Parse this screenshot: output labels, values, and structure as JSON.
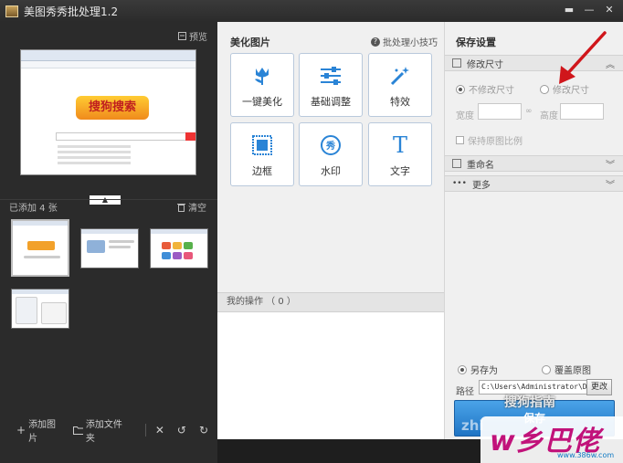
{
  "window": {
    "title": "美图秀秀批处理1.2",
    "controls": [
      "▬",
      "—",
      "✕"
    ]
  },
  "left_panel": {
    "preview_label": "预览",
    "added_count_label": "已添加 4 张",
    "clear_label": "清空",
    "collapse_glyph": "▲",
    "toolbar": {
      "add_image": "添加图片",
      "add_folder": "添加文件夹"
    }
  },
  "middle_panel": {
    "title": "美化图片",
    "tips_label": "批处理小技巧",
    "tools": [
      {
        "label": "一键美化",
        "icon": "tulip-icon"
      },
      {
        "label": "基础调整",
        "icon": "sliders-icon"
      },
      {
        "label": "特效",
        "icon": "magic-wand-icon"
      },
      {
        "label": "边框",
        "icon": "frame-icon"
      },
      {
        "label": "水印",
        "icon": "watermark-icon"
      },
      {
        "label": "文字",
        "icon": "text-icon"
      }
    ],
    "ops_label": "我的操作 （ 0 ）"
  },
  "right_panel": {
    "title": "保存设置",
    "resize_section": "修改尺寸",
    "no_resize": "不修改尺寸",
    "resize": "修改尺寸",
    "width_label": "宽度",
    "height_label": "高度",
    "keep_ratio": "保持原图比例",
    "rename_section": "重命名",
    "more_section": "更多",
    "save_as": "另存为",
    "overwrite": "覆盖原图",
    "path_label": "路径",
    "path_value": "C:\\Users\\Administrator\\De:",
    "change_button": "更改",
    "save_button": "保存"
  },
  "watermarks": {
    "sogou_guide": "搜狗指南",
    "site_logo": "w乡巴佬",
    "site_url": "www.386w.com",
    "zhi_text": "zhi"
  },
  "colors": {
    "accent_blue": "#2a84d6",
    "arrow_red": "#d0161b"
  }
}
